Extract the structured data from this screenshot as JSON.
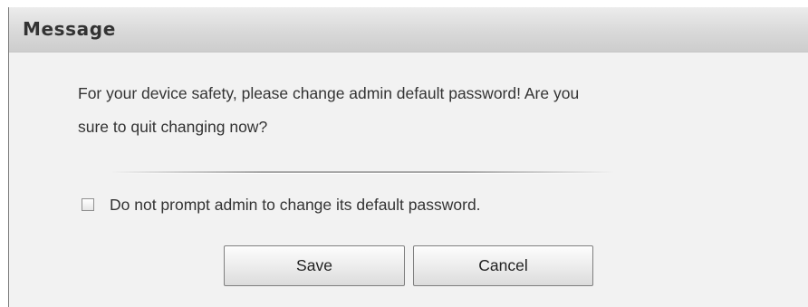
{
  "dialog": {
    "title": "Message",
    "message_line1": "For your device safety, please change admin default password! Are you",
    "message_line2": "sure to quit changing now?",
    "checkbox": {
      "label": "Do not prompt admin to change its default password.",
      "checked": false
    },
    "buttons": {
      "save": "Save",
      "cancel": "Cancel"
    }
  }
}
